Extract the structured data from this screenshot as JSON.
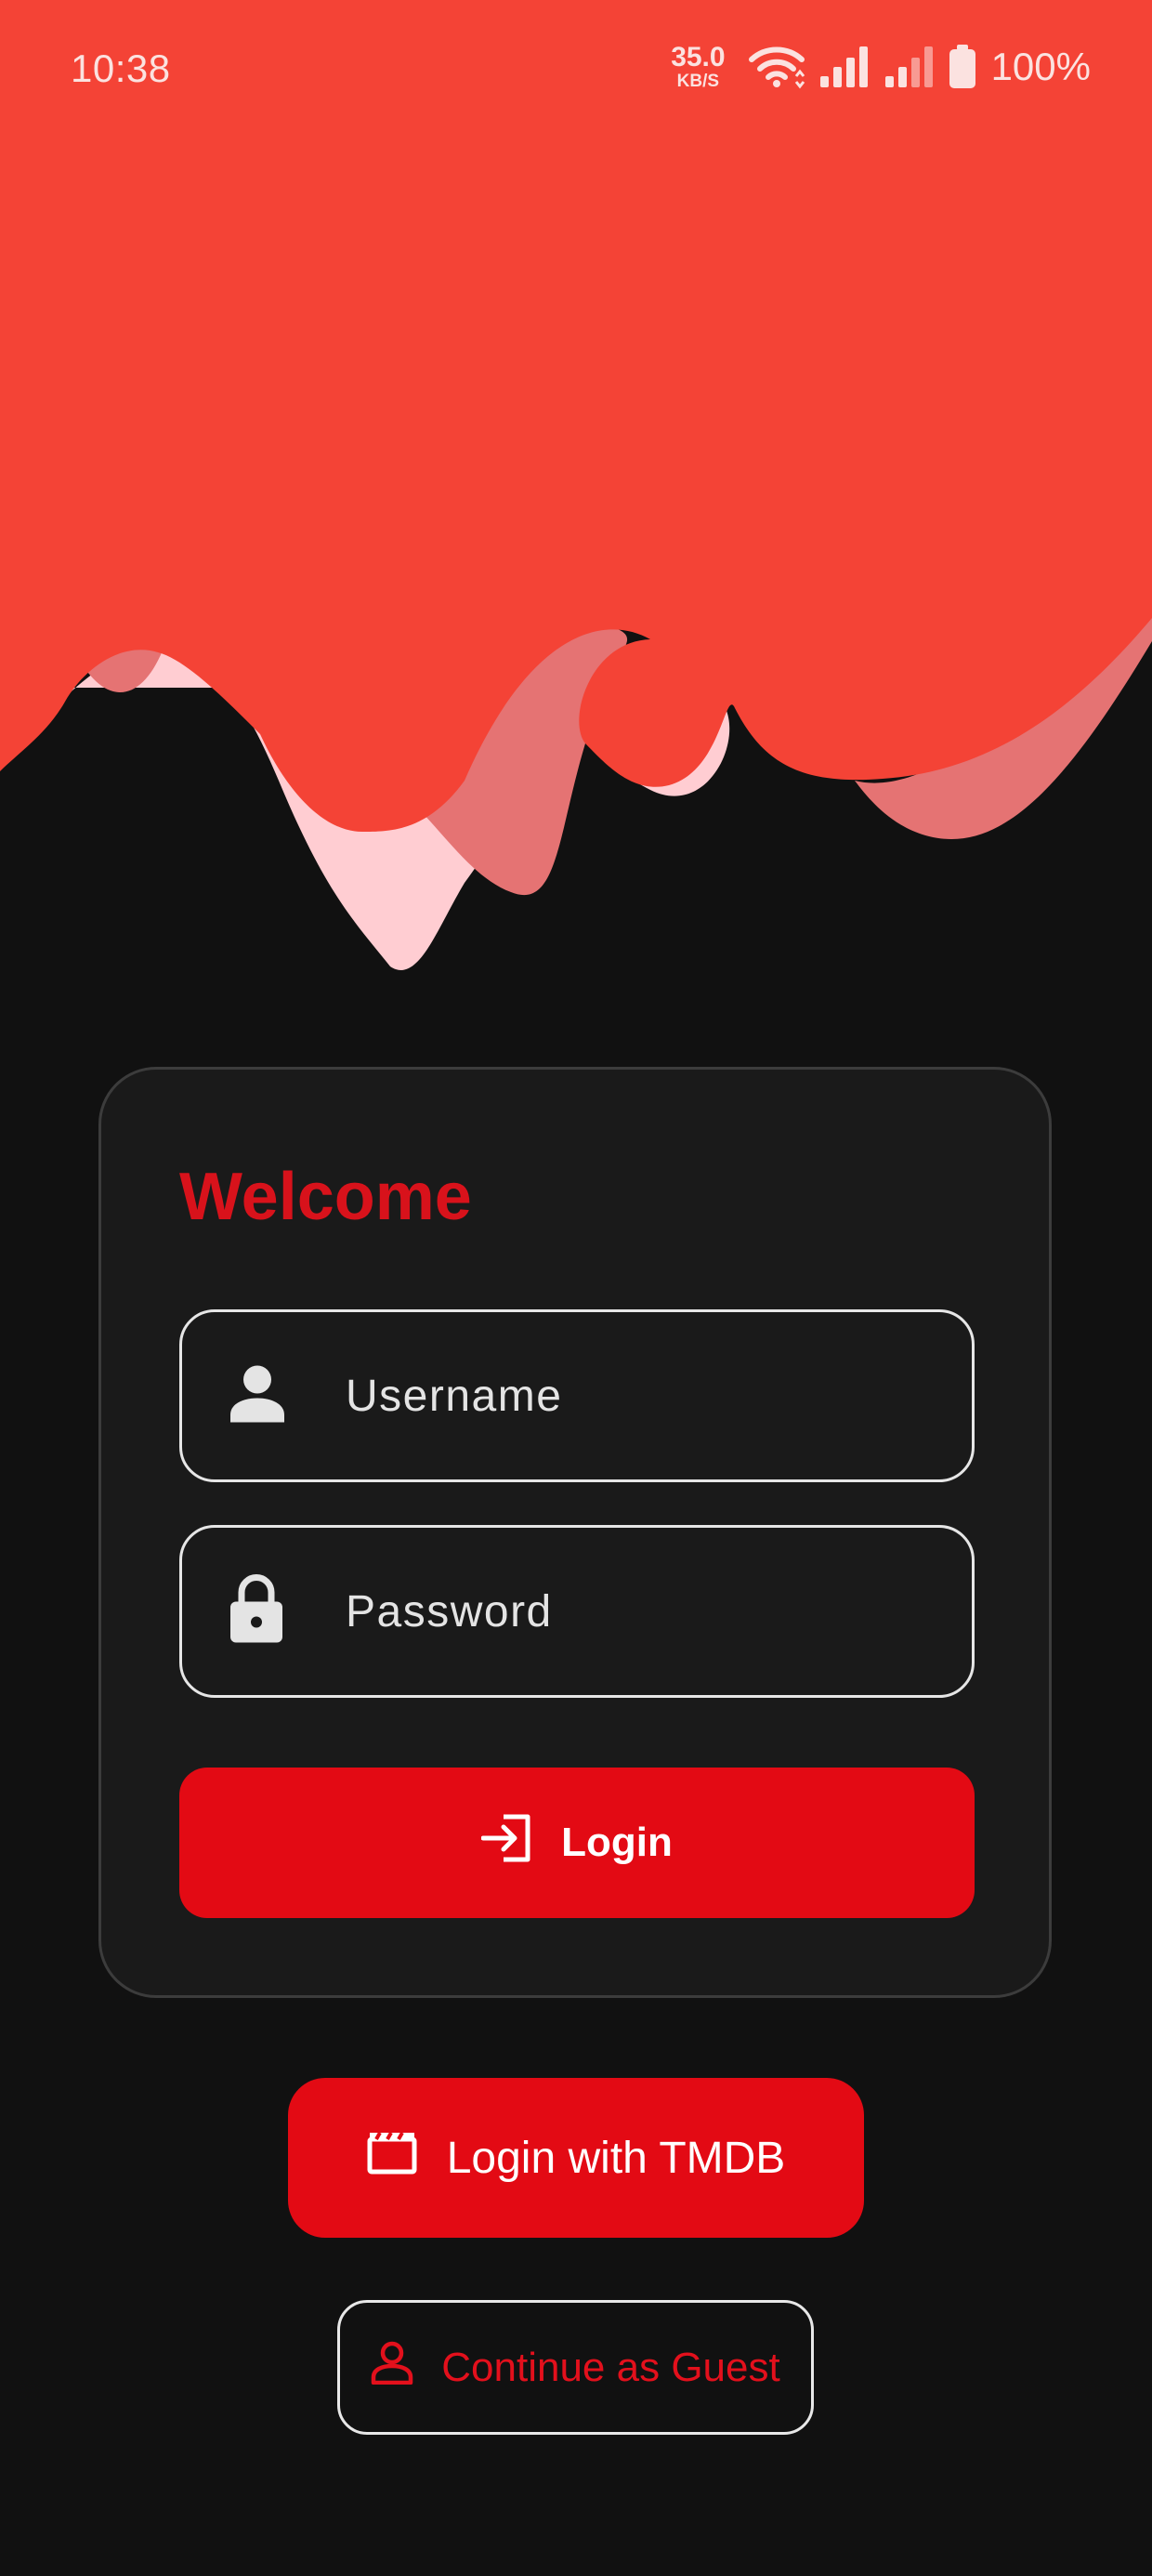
{
  "colors": {
    "background": "#111111",
    "header_red": "#f44336",
    "wave_pink": "#ffcdd2",
    "wave_rose": "#e57373",
    "accent_red": "#e30a14",
    "card_bg": "#1a1a1a"
  },
  "status_bar": {
    "time": "10:38",
    "net_speed_value": "35.0",
    "net_speed_unit": "KB/S",
    "battery_percent": "100%",
    "icons": [
      "wifi-icon",
      "signal-icon",
      "signal-icon",
      "battery-icon"
    ]
  },
  "login_card": {
    "title": "Welcome",
    "username": {
      "placeholder": "Username",
      "value": "",
      "icon": "person-icon"
    },
    "password": {
      "placeholder": "Password",
      "value": "",
      "icon": "lock-icon"
    },
    "login_button": {
      "label": "Login",
      "icon": "login-icon"
    }
  },
  "tmdb_button": {
    "label": "Login with TMDB",
    "icon": "clapperboard-icon"
  },
  "guest_button": {
    "label": "Continue as Guest",
    "icon": "person-outline-icon"
  }
}
